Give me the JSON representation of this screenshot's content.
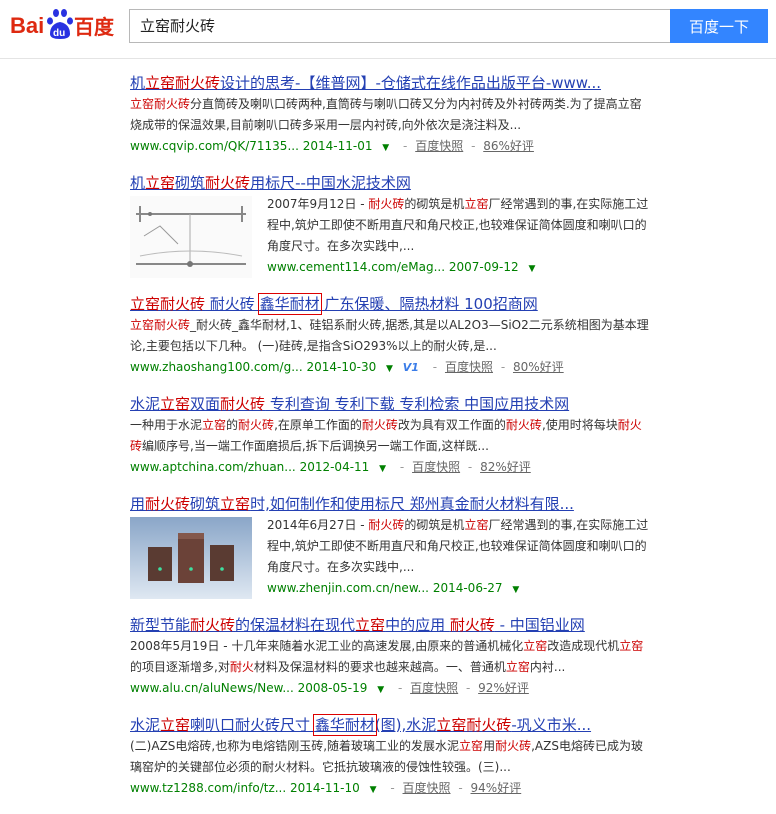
{
  "header": {
    "logo_bai": "Bai",
    "logo_du": "du",
    "logo_cn": "百度",
    "query": "立窑耐火砖",
    "search_button": "百度一下"
  },
  "results": [
    {
      "title": [
        {
          "t": "机"
        },
        {
          "t": "立窑耐火砖",
          "hl": true
        },
        {
          "t": "设计的思考-【维普网】-仓储式在线作品出版平台-www..."
        }
      ],
      "abstract": [
        {
          "t": "立窑耐火砖",
          "hl": true
        },
        {
          "t": "分直筒砖及喇叭口砖两种,直筒砖与喇叭口砖又分为内衬砖及外衬砖两类.为了提高立窑烧成带的保温效果,目前喇叭口砖多采用一层内衬砖,向外依次是浇注料及..."
        }
      ],
      "url": "www.cqvip.com/QK/71135...",
      "date": "2014-11-01",
      "cache": "百度快照",
      "rating": "86%好评"
    },
    {
      "title": [
        {
          "t": "机"
        },
        {
          "t": "立窑",
          "hl": true
        },
        {
          "t": "砌筑"
        },
        {
          "t": "耐火砖",
          "hl": true
        },
        {
          "t": "用标尺--中国水泥技术网"
        }
      ],
      "abstract": [
        {
          "t": "2007年9月12日 - "
        },
        {
          "t": "耐火砖",
          "hl": true
        },
        {
          "t": "的砌筑是机"
        },
        {
          "t": "立窑",
          "hl": true
        },
        {
          "t": "厂经常遇到的事,在实际施工过程中,筑炉工即使不断用直尺和角尺校正,也较难保证简体圆度和喇叭口的角度尺寸。在多次实践中,..."
        }
      ],
      "url": "www.cement114.com/eMag...",
      "date": "2007-09-12"
    },
    {
      "title": [
        {
          "t": "立窑耐火砖",
          "hl": true
        },
        {
          "t": " 耐火砖 "
        },
        {
          "t": "鑫华耐材",
          "boxed": true
        },
        {
          "t": " 广东保暖、隔热材料 100招商网"
        }
      ],
      "abstract": [
        {
          "t": "立窑耐火砖",
          "hl": true
        },
        {
          "t": "_耐火砖_鑫华耐材,1、硅铝系耐火砖,据悉,其是以AL2O3—SiO2二元系统相图为基本理论,主要包括以下几种。 (一)硅砖,是指含SiO293%以上的耐火砖,是..."
        }
      ],
      "url": "www.zhaoshang100.com/g...",
      "date": "2014-10-30",
      "badge": "V1",
      "cache": "百度快照",
      "rating": "80%好评"
    },
    {
      "title": [
        {
          "t": "水泥"
        },
        {
          "t": "立窑",
          "hl": true
        },
        {
          "t": "双面"
        },
        {
          "t": "耐火砖",
          "hl": true
        },
        {
          "t": " 专利查询 专利下载 专利检索 中国应用技术网"
        }
      ],
      "abstract": [
        {
          "t": "一种用于水泥"
        },
        {
          "t": "立窑",
          "hl": true
        },
        {
          "t": "的"
        },
        {
          "t": "耐火砖",
          "hl": true
        },
        {
          "t": ",在原单工作面的"
        },
        {
          "t": "耐火砖",
          "hl": true
        },
        {
          "t": "改为具有双工作面的"
        },
        {
          "t": "耐火砖",
          "hl": true
        },
        {
          "t": ",使用时将每块"
        },
        {
          "t": "耐火砖",
          "hl": true
        },
        {
          "t": "编顺序号,当一端工作面磨损后,拆下后调换另一端工作面,这样既..."
        }
      ],
      "url": "www.aptchina.com/zhuan...",
      "date": "2012-04-11",
      "cache": "百度快照",
      "rating": "82%好评"
    },
    {
      "title": [
        {
          "t": "用"
        },
        {
          "t": "耐火砖",
          "hl": true
        },
        {
          "t": "砌筑"
        },
        {
          "t": "立窑",
          "hl": true
        },
        {
          "t": "时,如何制作和使用标尺 郑州真金耐火材料有限..."
        }
      ],
      "abstract": [
        {
          "t": "2014年6月27日 - "
        },
        {
          "t": "耐火砖",
          "hl": true
        },
        {
          "t": "的砌筑是机"
        },
        {
          "t": "立窑",
          "hl": true
        },
        {
          "t": "厂经常遇到的事,在实际施工过程中,筑炉工即使不断用直尺和角尺校正,也较难保证简体圆度和喇叭口的角度尺寸。在多次实践中,..."
        }
      ],
      "url": "www.zhenjin.com.cn/new...",
      "date": "2014-06-27"
    },
    {
      "title": [
        {
          "t": "新型节能"
        },
        {
          "t": "耐火砖",
          "hl": true
        },
        {
          "t": "的保温材料在现代"
        },
        {
          "t": "立窑",
          "hl": true
        },
        {
          "t": "中的应用 "
        },
        {
          "t": "耐火砖",
          "hl": true
        },
        {
          "t": " - 中国铝业网"
        }
      ],
      "abstract": [
        {
          "t": "2008年5月19日 - 十几年来随着水泥工业的高速发展,由原来的普通机械化"
        },
        {
          "t": "立窑",
          "hl": true
        },
        {
          "t": "改造成现代机"
        },
        {
          "t": "立窑",
          "hl": true
        },
        {
          "t": "的项目逐渐增多,对"
        },
        {
          "t": "耐火",
          "hl": true
        },
        {
          "t": "材料及保温材料的要求也越来越高。一、普通机"
        },
        {
          "t": "立窑",
          "hl": true
        },
        {
          "t": "内衬..."
        }
      ],
      "url": "www.alu.cn/aluNews/New...",
      "date": "2008-05-19",
      "cache": "百度快照",
      "rating": "92%好评"
    },
    {
      "title": [
        {
          "t": "水泥"
        },
        {
          "t": "立窑",
          "hl": true
        },
        {
          "t": "喇叭口耐火砖尺寸 "
        },
        {
          "t": "鑫华耐材",
          "boxed": true
        },
        {
          "t": "(图),水泥"
        },
        {
          "t": "立窑耐火砖",
          "hl": true
        },
        {
          "t": "-巩义市米..."
        }
      ],
      "abstract": [
        {
          "t": "(二)AZS电熔砖,也称为电熔锆刚玉砖,随着玻璃工业的发展水泥"
        },
        {
          "t": "立窑",
          "hl": true
        },
        {
          "t": "用"
        },
        {
          "t": "耐火砖",
          "hl": true
        },
        {
          "t": ",AZS电熔砖已成为玻璃窑炉的关键部位必须的耐火材料。它抵抗玻璃液的侵蚀性较强。(三)..."
        }
      ],
      "url": "www.tz1288.com/info/tz...",
      "date": "2014-11-10",
      "cache": "百度快照",
      "rating": "94%好评"
    }
  ]
}
